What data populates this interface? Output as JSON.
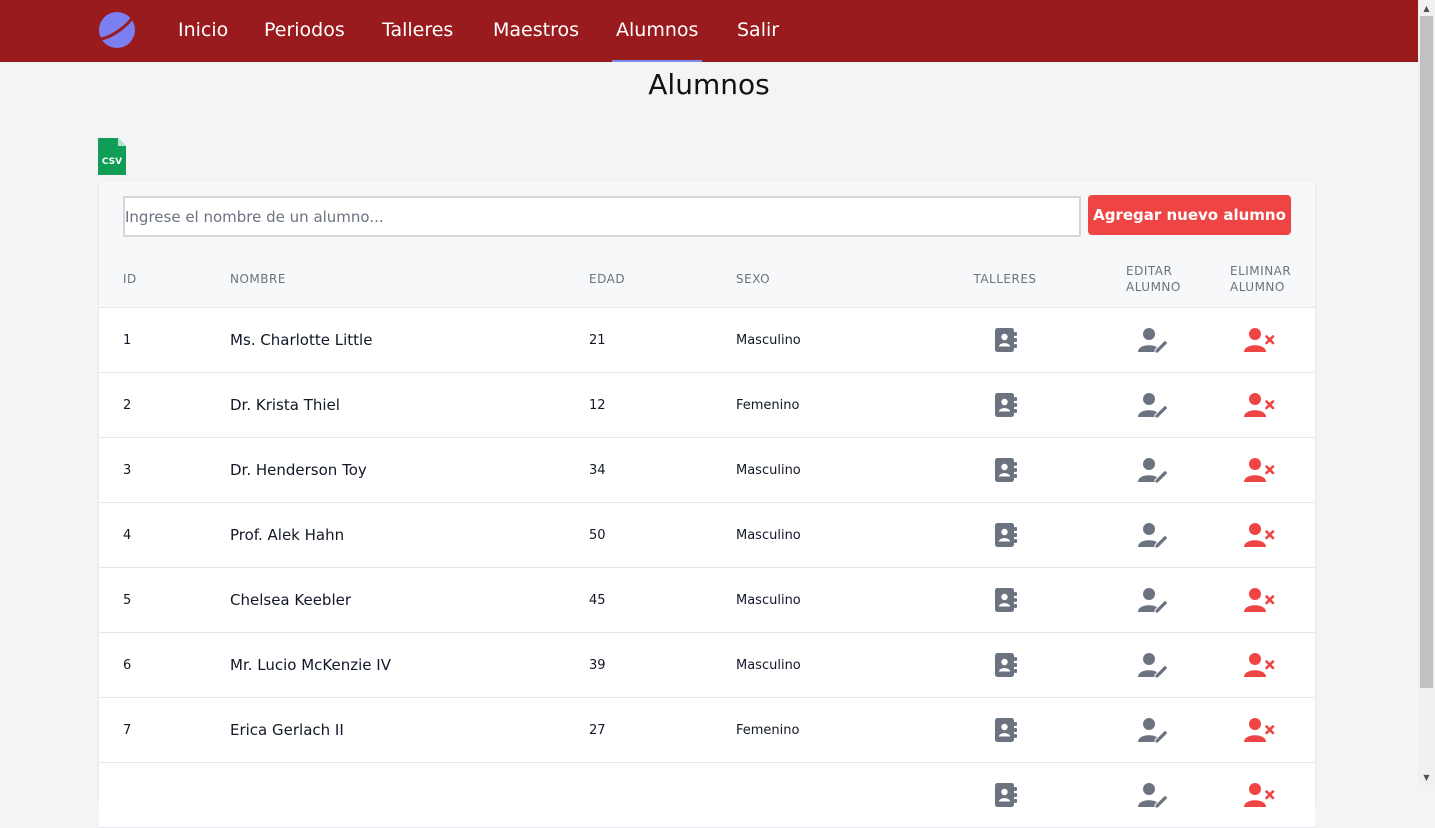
{
  "nav": {
    "items": [
      {
        "label": "Inicio",
        "active": false
      },
      {
        "label": "Periodos",
        "active": false
      },
      {
        "label": "Talleres",
        "active": false
      },
      {
        "label": "Maestros",
        "active": false
      },
      {
        "label": "Alumnos",
        "active": true
      },
      {
        "label": "Salir",
        "active": false
      }
    ],
    "background_color": "#991b1e",
    "logo_icon": "planet-logo-icon"
  },
  "page": {
    "title": "Alumnos",
    "csv_icon": "csv-file-icon",
    "csv_label": "CSV"
  },
  "search": {
    "placeholder": "Ingrese el nombre de un alumno...",
    "value": ""
  },
  "add_button": {
    "label": "Agregar nuevo alumno",
    "color": "#ef4444"
  },
  "table": {
    "headers": {
      "id": "ID",
      "nombre": "NOMBRE",
      "edad": "EDAD",
      "sexo": "SEXO",
      "talleres": "TALLERES",
      "editar": "EDITAR ALUMNO",
      "eliminar": "ELIMINAR ALUMNO"
    },
    "rows": [
      {
        "id": "1",
        "nombre": "Ms. Charlotte Little",
        "edad": "21",
        "sexo": "Masculino"
      },
      {
        "id": "2",
        "nombre": "Dr. Krista Thiel",
        "edad": "12",
        "sexo": "Femenino"
      },
      {
        "id": "3",
        "nombre": "Dr. Henderson Toy",
        "edad": "34",
        "sexo": "Masculino"
      },
      {
        "id": "4",
        "nombre": "Prof. Alek Hahn",
        "edad": "50",
        "sexo": "Masculino"
      },
      {
        "id": "5",
        "nombre": "Chelsea Keebler",
        "edad": "45",
        "sexo": "Masculino"
      },
      {
        "id": "6",
        "nombre": "Mr. Lucio McKenzie IV",
        "edad": "39",
        "sexo": "Masculino"
      },
      {
        "id": "7",
        "nombre": "Erica Gerlach II",
        "edad": "27",
        "sexo": "Femenino"
      },
      {
        "id": "",
        "nombre": "",
        "edad": "",
        "sexo": ""
      }
    ],
    "icons": {
      "talleres": "address-book-icon",
      "editar": "user-edit-icon",
      "eliminar": "user-delete-icon"
    },
    "colors": {
      "gray_icon": "#6b7280",
      "delete_icon": "#ef4444"
    }
  }
}
